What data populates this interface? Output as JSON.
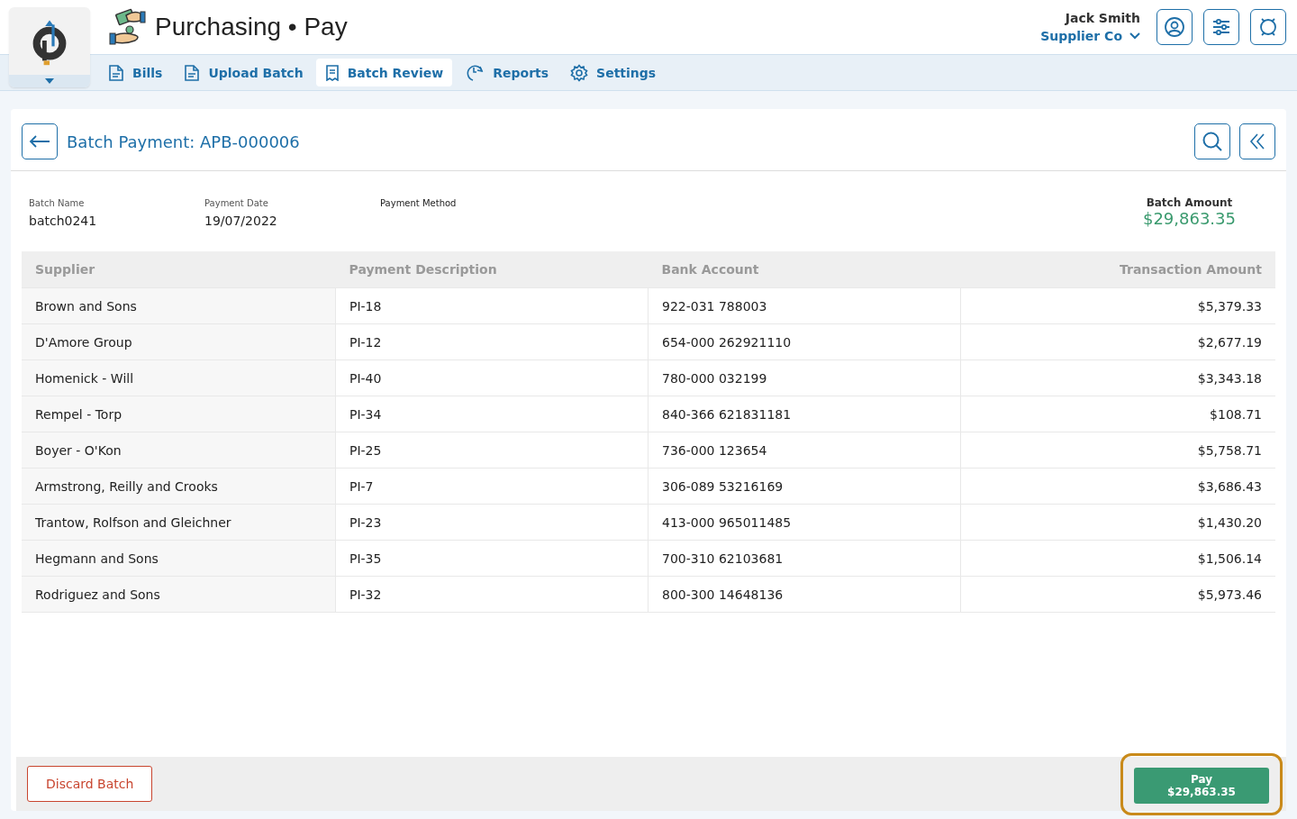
{
  "app": {
    "title": "Purchasing • Pay"
  },
  "user": {
    "name": "Jack Smith",
    "company": "Supplier Co"
  },
  "nav": [
    {
      "label": "Bills",
      "selected": false
    },
    {
      "label": "Upload Batch",
      "selected": false
    },
    {
      "label": "Batch Review",
      "selected": true
    },
    {
      "label": "Reports",
      "selected": false
    },
    {
      "label": "Settings",
      "selected": false
    }
  ],
  "page": {
    "title": "Batch Payment: APB-000006"
  },
  "fields": [
    {
      "label": "Batch Name",
      "value": "batch0241"
    },
    {
      "label": "Payment Date",
      "value": "19/07/2022"
    },
    {
      "label": "Payment Method"
    }
  ],
  "batch_amount": {
    "label": "Batch Amount",
    "value": "$29,863.35"
  },
  "table": {
    "columns": [
      "Supplier",
      "Payment Description",
      "Bank Account",
      "Transaction Amount"
    ],
    "rows": [
      [
        "Brown and Sons",
        "PI-18",
        "922-031 788003",
        "$5,379.33"
      ],
      [
        "D'Amore Group",
        "PI-12",
        "654-000 262921110",
        "$2,677.19"
      ],
      [
        "Homenick - Will",
        "PI-40",
        "780-000 032199",
        "$3,343.18"
      ],
      [
        "Rempel - Torp",
        "PI-34",
        "840-366 621831181",
        "$108.71"
      ],
      [
        "Boyer - O'Kon",
        "PI-25",
        "736-000 123654",
        "$5,758.71"
      ],
      [
        "Armstrong, Reilly and Crooks",
        "PI-7",
        "306-089 53216169",
        "$3,686.43"
      ],
      [
        "Trantow, Rolfson and Gleichner",
        "PI-23",
        "413-000 965011485",
        "$1,430.20"
      ],
      [
        "Hegmann and Sons",
        "PI-35",
        "700-310 62103681",
        "$1,506.14"
      ],
      [
        "Rodriguez and Sons",
        "PI-32",
        "800-300 14648136",
        "$5,973.46"
      ]
    ]
  },
  "footer": {
    "discard": "Discard Batch",
    "pay_label": "Pay",
    "pay_amount": "$29,863.35",
    "pay_highlighted": true
  }
}
